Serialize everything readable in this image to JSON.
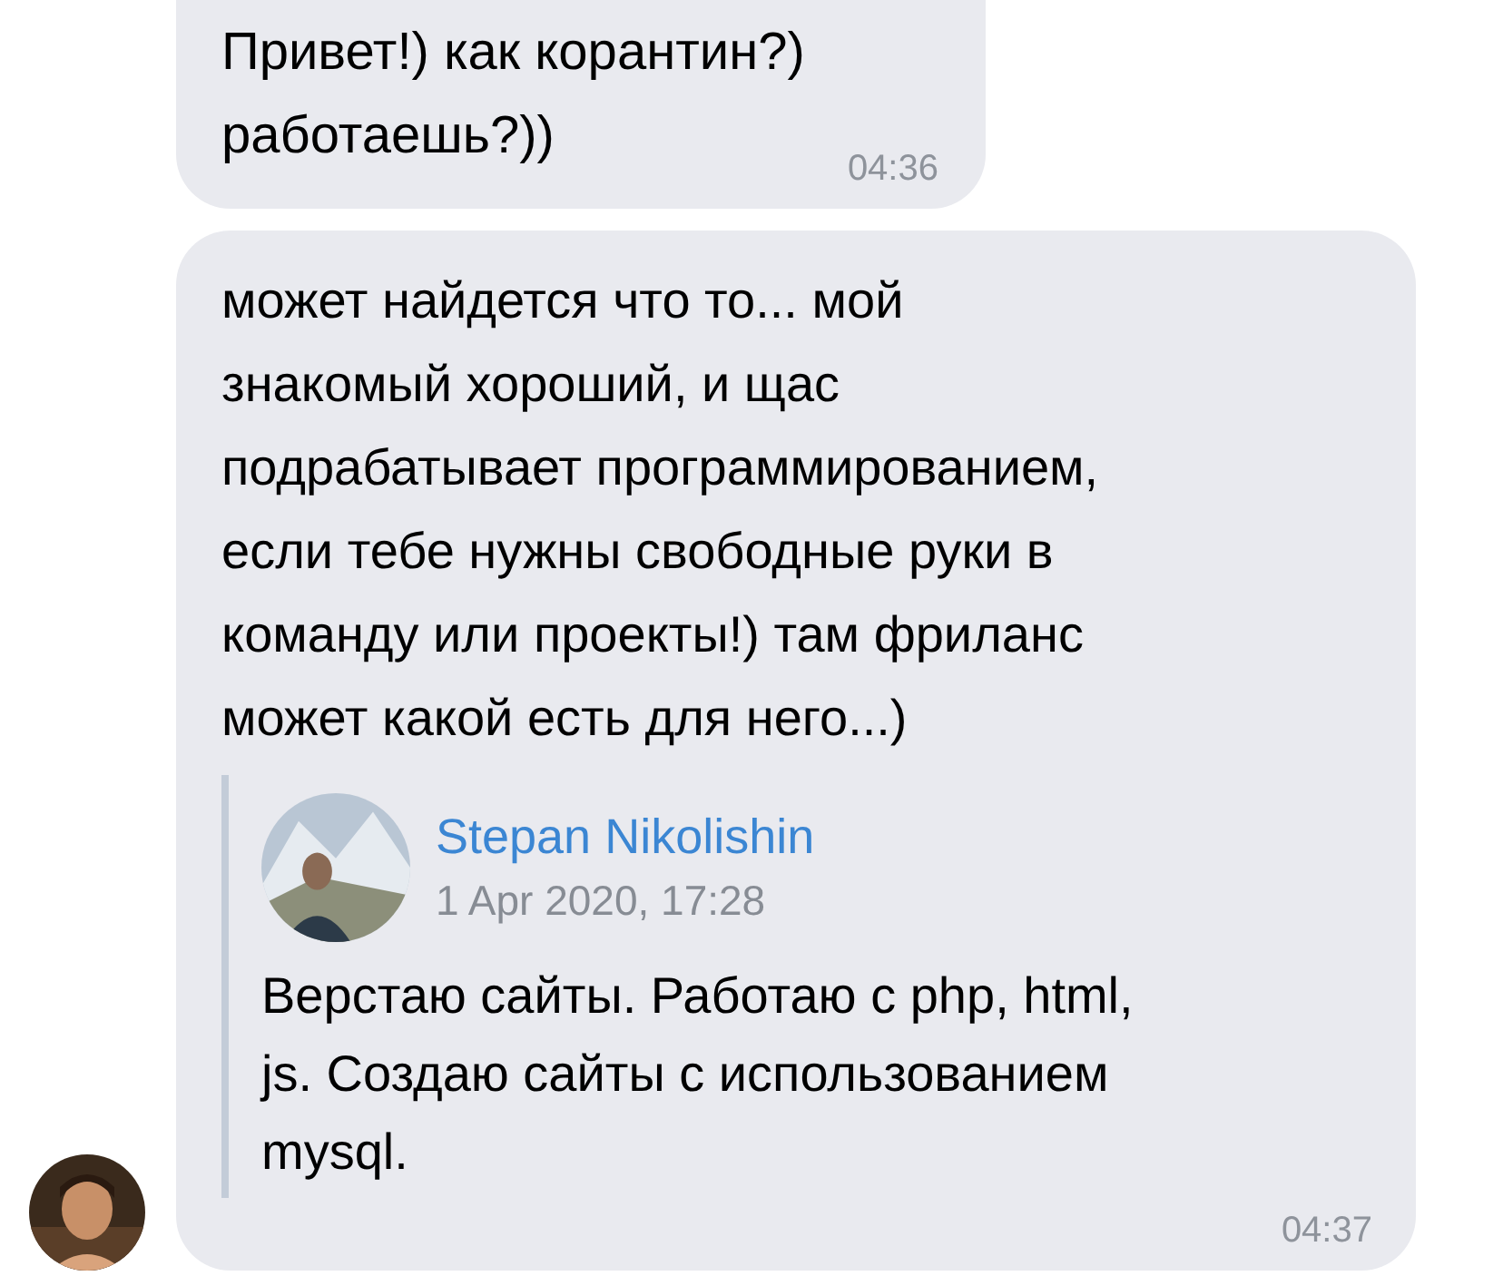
{
  "messages": [
    {
      "kind": "plain",
      "text": "Привет!) как корантин?) работаешь?))",
      "time": "04:36"
    },
    {
      "kind": "with_quote",
      "text": "может найдется что то... мой знакомый хороший, и щас подрабатывает программированием, если тебе нужны свободные руки в команду или проекты!) там фриланс может какой есть для него...)",
      "quote": {
        "author": "Stepan Nikolishin",
        "date": "1 Apr 2020, 17:28",
        "text": "Верстаю сайты. Работаю с php, html, js. Создаю сайты с использованием mysql."
      },
      "time": "04:37"
    }
  ]
}
